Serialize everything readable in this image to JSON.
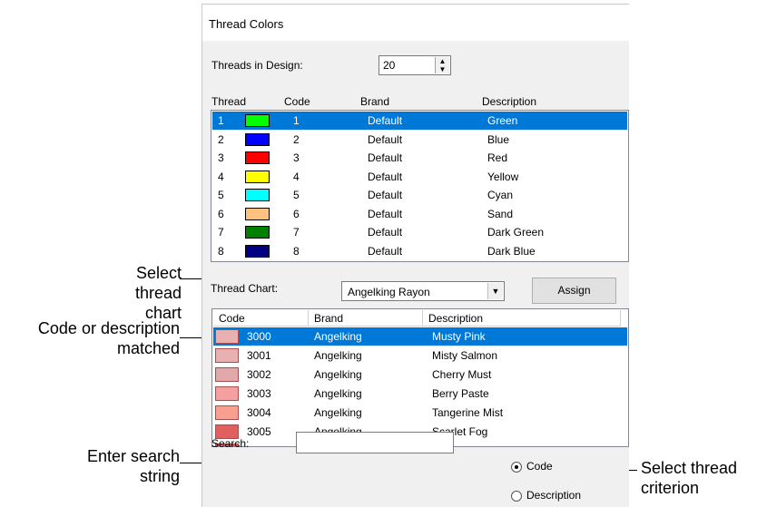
{
  "window": {
    "title": "Thread Colors"
  },
  "threads_in_design": {
    "label": "Threads in Design:",
    "value": "20"
  },
  "design_threads": {
    "headers": [
      "Thread",
      "Code",
      "Brand",
      "Description"
    ],
    "rows": [
      {
        "thread": "1",
        "code": "1",
        "brand": "Default",
        "description": "Green",
        "color": "#00ff00",
        "selected": true
      },
      {
        "thread": "2",
        "code": "2",
        "brand": "Default",
        "description": "Blue",
        "color": "#0000ff"
      },
      {
        "thread": "3",
        "code": "3",
        "brand": "Default",
        "description": "Red",
        "color": "#ff0000"
      },
      {
        "thread": "4",
        "code": "4",
        "brand": "Default",
        "description": "Yellow",
        "color": "#ffff00"
      },
      {
        "thread": "5",
        "code": "5",
        "brand": "Default",
        "description": "Cyan",
        "color": "#00ffff"
      },
      {
        "thread": "6",
        "code": "6",
        "brand": "Default",
        "description": "Sand",
        "color": "#ffc080"
      },
      {
        "thread": "7",
        "code": "7",
        "brand": "Default",
        "description": "Dark Green",
        "color": "#008000"
      },
      {
        "thread": "8",
        "code": "8",
        "brand": "Default",
        "description": "Dark Blue",
        "color": "#000080"
      }
    ]
  },
  "thread_chart": {
    "label": "Thread Chart:",
    "value": "Angelking Rayon",
    "assign_label": "Assign"
  },
  "chart_threads": {
    "headers": [
      "Code",
      "Brand",
      "Description"
    ],
    "rows": [
      {
        "code": "3000",
        "brand": "Angelking",
        "description": "Musty Pink",
        "color": "#e8b0b0",
        "selected": true
      },
      {
        "code": "3001",
        "brand": "Angelking",
        "description": "Misty Salmon",
        "color": "#e8b0b0"
      },
      {
        "code": "3002",
        "brand": "Angelking",
        "description": "Cherry Must",
        "color": "#e0a8a8"
      },
      {
        "code": "3003",
        "brand": "Angelking",
        "description": "Berry Paste",
        "color": "#f4a0a0"
      },
      {
        "code": "3004",
        "brand": "Angelking",
        "description": "Tangerine Mist",
        "color": "#f8a090"
      },
      {
        "code": "3005",
        "brand": "Angelking",
        "description": "Scarlet Fog",
        "color": "#e06060"
      },
      {
        "code": "",
        "brand": "",
        "description": "",
        "color": "#e85050"
      }
    ]
  },
  "search": {
    "label": "Search:",
    "value": ""
  },
  "criterion": {
    "options": [
      "Code",
      "Description"
    ],
    "selected": "Code"
  },
  "callouts": {
    "select_chart": "Select\nthread chart",
    "code_matched": "Code or description\nmatched",
    "enter_search": "Enter search\nstring",
    "select_criterion": "Select thread\ncriterion"
  }
}
